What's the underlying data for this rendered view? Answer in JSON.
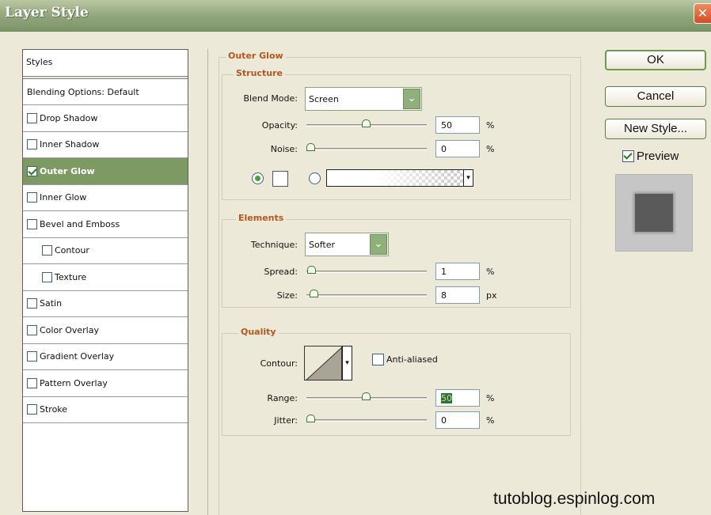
{
  "window": {
    "title": "Layer Style",
    "close_icon": "close-icon"
  },
  "styles_panel": {
    "header": "Styles",
    "blending_options": "Blending Options: Default",
    "items": [
      {
        "label": "Drop Shadow",
        "checked": false,
        "indent": false,
        "selected": false
      },
      {
        "label": "Inner Shadow",
        "checked": false,
        "indent": false,
        "selected": false
      },
      {
        "label": "Outer Glow",
        "checked": true,
        "indent": false,
        "selected": true
      },
      {
        "label": "Inner Glow",
        "checked": false,
        "indent": false,
        "selected": false
      },
      {
        "label": "Bevel and Emboss",
        "checked": false,
        "indent": false,
        "selected": false
      },
      {
        "label": "Contour",
        "checked": false,
        "indent": true,
        "selected": false
      },
      {
        "label": "Texture",
        "checked": false,
        "indent": true,
        "selected": false
      },
      {
        "label": "Satin",
        "checked": false,
        "indent": false,
        "selected": false
      },
      {
        "label": "Color Overlay",
        "checked": false,
        "indent": false,
        "selected": false
      },
      {
        "label": "Gradient Overlay",
        "checked": false,
        "indent": false,
        "selected": false
      },
      {
        "label": "Pattern Overlay",
        "checked": false,
        "indent": false,
        "selected": false
      },
      {
        "label": "Stroke",
        "checked": false,
        "indent": false,
        "selected": false
      }
    ]
  },
  "outer_glow": {
    "title": "Outer Glow",
    "structure": {
      "title": "Structure",
      "blend_mode_label": "Blend Mode:",
      "blend_mode_value": "Screen",
      "opacity_label": "Opacity:",
      "opacity_value": "50",
      "opacity_unit": "%",
      "noise_label": "Noise:",
      "noise_value": "0",
      "noise_unit": "%",
      "glow_source": "color"
    },
    "elements": {
      "title": "Elements",
      "technique_label": "Technique:",
      "technique_value": "Softer",
      "spread_label": "Spread:",
      "spread_value": "1",
      "spread_unit": "%",
      "size_label": "Size:",
      "size_value": "8",
      "size_unit": "px"
    },
    "quality": {
      "title": "Quality",
      "contour_label": "Contour:",
      "anti_aliased_label": "Anti-aliased",
      "anti_aliased_checked": false,
      "range_label": "Range:",
      "range_value": "50",
      "range_unit": "%",
      "jitter_label": "Jitter:",
      "jitter_value": "0",
      "jitter_unit": "%"
    }
  },
  "buttons": {
    "ok": "OK",
    "cancel": "Cancel",
    "new_style": "New Style..."
  },
  "preview": {
    "label": "Preview",
    "checked": true
  },
  "watermark": "tutoblog.espinlog.com",
  "colors": {
    "accent_green": "#7e9a63",
    "group_title": "#b5561f",
    "dialog_bg": "#ece9d8"
  }
}
